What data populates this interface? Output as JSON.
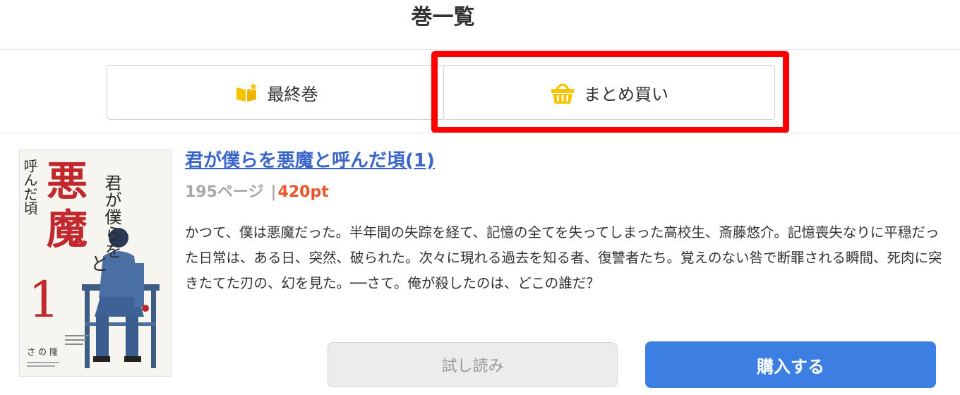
{
  "page_title": "巻一覧",
  "tabs": {
    "final_volume": {
      "label": "最終巻",
      "icon": "book-star-icon"
    },
    "bulk_purchase": {
      "label": "まとめ買い",
      "icon": "basket-icon"
    }
  },
  "book": {
    "cover": {
      "title_vertical_1": "君が僕らを",
      "title_big_1": "悪",
      "title_big_2": "魔",
      "title_small": "と",
      "title_vertical_2": "呼んだ頃",
      "volume": "1",
      "author": "さの隆"
    },
    "title": "君が僕らを悪魔と呼んだ頃(1)",
    "pages": "195ページ",
    "separator": "|",
    "price": "420pt",
    "description": "かつて、僕は悪魔だった。半年間の失踪を経て、記憶の全てを失ってしまった高校生、斎藤悠介。記憶喪失なりに平穏だった日常は、ある日、突然、破られた。次々に現れる過去を知る者、復讐者たち。覚えのない咎で断罪される瞬間、死肉に突きたてた刃の、幻を見た。──さて。俺が殺したのは、どこの誰だ？"
  },
  "actions": {
    "trial_label": "試し読み",
    "buy_label": "購入する"
  },
  "colors": {
    "link": "#3a66c9",
    "price": "#e8562a",
    "buy_button": "#3d7ee3",
    "highlight": "#ff0000",
    "icon_yellow": "#f5c400"
  }
}
